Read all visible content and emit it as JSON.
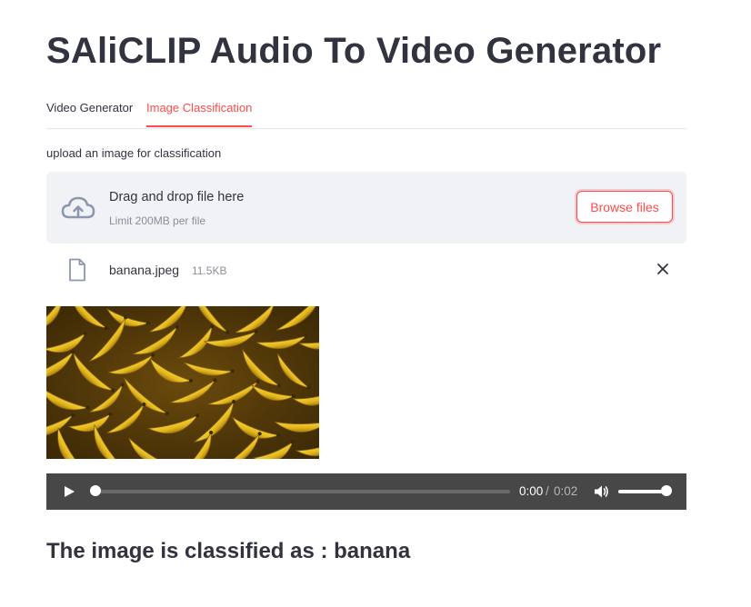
{
  "header": {
    "title": "SAliCLIP Audio To Video Generator"
  },
  "tabs": [
    {
      "label": "Video Generator",
      "active": false
    },
    {
      "label": "Image Classification",
      "active": true
    }
  ],
  "uploader": {
    "label": "upload an image for classification",
    "drop_text": "Drag and drop file here",
    "limit_text": "Limit 200MB per file",
    "browse_label": "Browse files",
    "icon": "cloud-upload-icon"
  },
  "uploaded_file": {
    "name": "banana.jpeg",
    "size": "11.5KB",
    "icon": "file-icon"
  },
  "image": {
    "subject": "banana-bunch-photo"
  },
  "audio": {
    "current_time": "0:00",
    "separator": "/",
    "duration": "0:02",
    "progress": 0,
    "volume": 1.0
  },
  "result": {
    "text": "The image is classified as : banana"
  },
  "colors": {
    "accent": "#ff4b4b",
    "text": "#31333f",
    "muted": "#8c8e98",
    "dropzone_bg": "#f0f2f6",
    "player_bg": "#474747"
  }
}
